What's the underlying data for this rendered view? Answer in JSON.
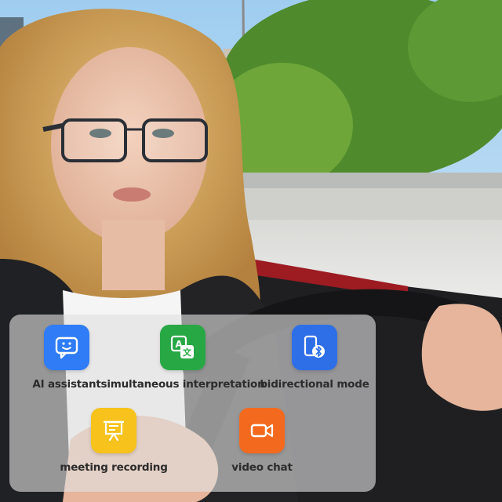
{
  "features": [
    {
      "label": "AI assistant",
      "icon": "chat-smiley-icon",
      "color": "#2F7CF6"
    },
    {
      "label": "simultaneous interpretation",
      "icon": "translate-icon",
      "color": "#27A845"
    },
    {
      "label": "bidirectional mode",
      "icon": "phone-bluetooth-icon",
      "color": "#2E6FE8"
    },
    {
      "label": "meeting recording",
      "icon": "presentation-icon",
      "color": "#F6C21B"
    },
    {
      "label": "video chat",
      "icon": "video-camera-icon",
      "color": "#F36A1E"
    }
  ]
}
